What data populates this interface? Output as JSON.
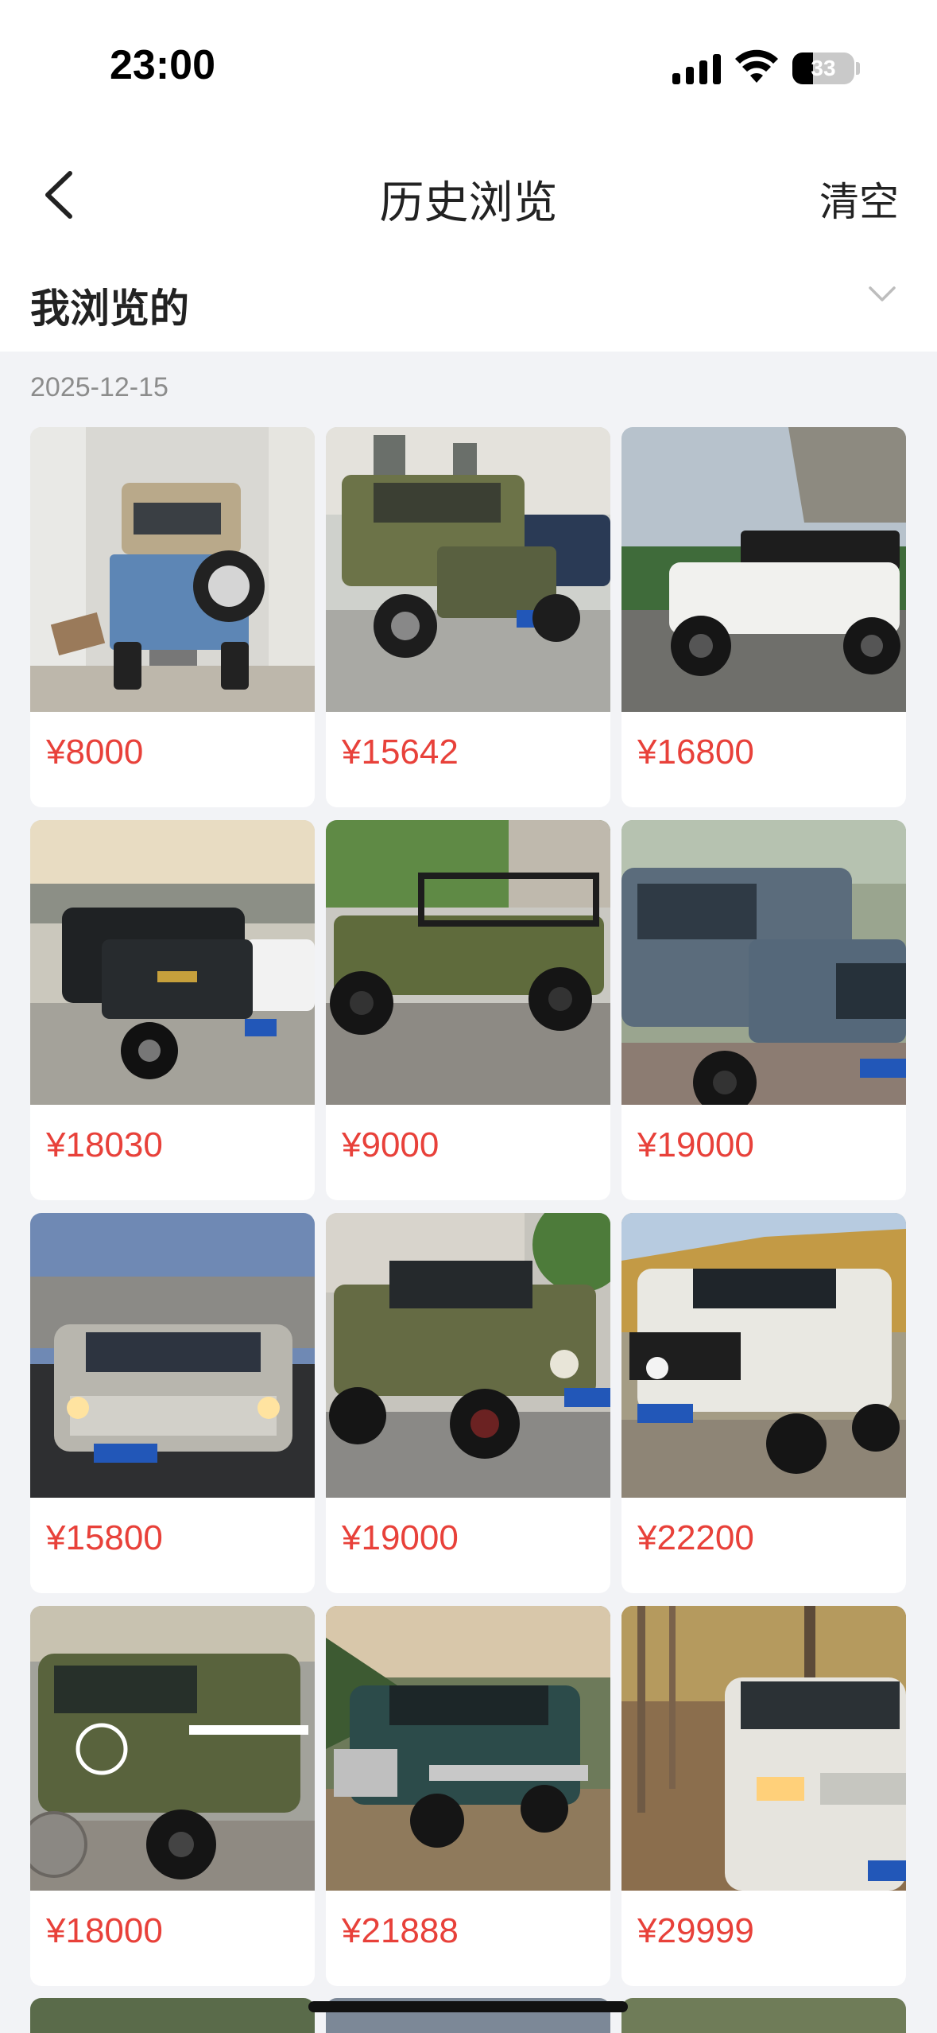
{
  "status_bar": {
    "time": "23:00",
    "battery": "33",
    "battery_level": 0.33
  },
  "nav": {
    "title": "历史浏览",
    "clear_label": "清空"
  },
  "filter": {
    "label": "我浏览的"
  },
  "section": {
    "date": "2025-12-15"
  },
  "colors": {
    "price": "#e8413a",
    "background": "#f2f3f6",
    "card": "#ffffff"
  },
  "items": [
    {
      "price": "¥8000"
    },
    {
      "price": "¥15642"
    },
    {
      "price": "¥16800"
    },
    {
      "price": "¥18030"
    },
    {
      "price": "¥9000"
    },
    {
      "price": "¥19000"
    },
    {
      "price": "¥15800"
    },
    {
      "price": "¥19000"
    },
    {
      "price": "¥22200"
    },
    {
      "price": "¥18000"
    },
    {
      "price": "¥21888"
    },
    {
      "price": "¥29999"
    }
  ]
}
